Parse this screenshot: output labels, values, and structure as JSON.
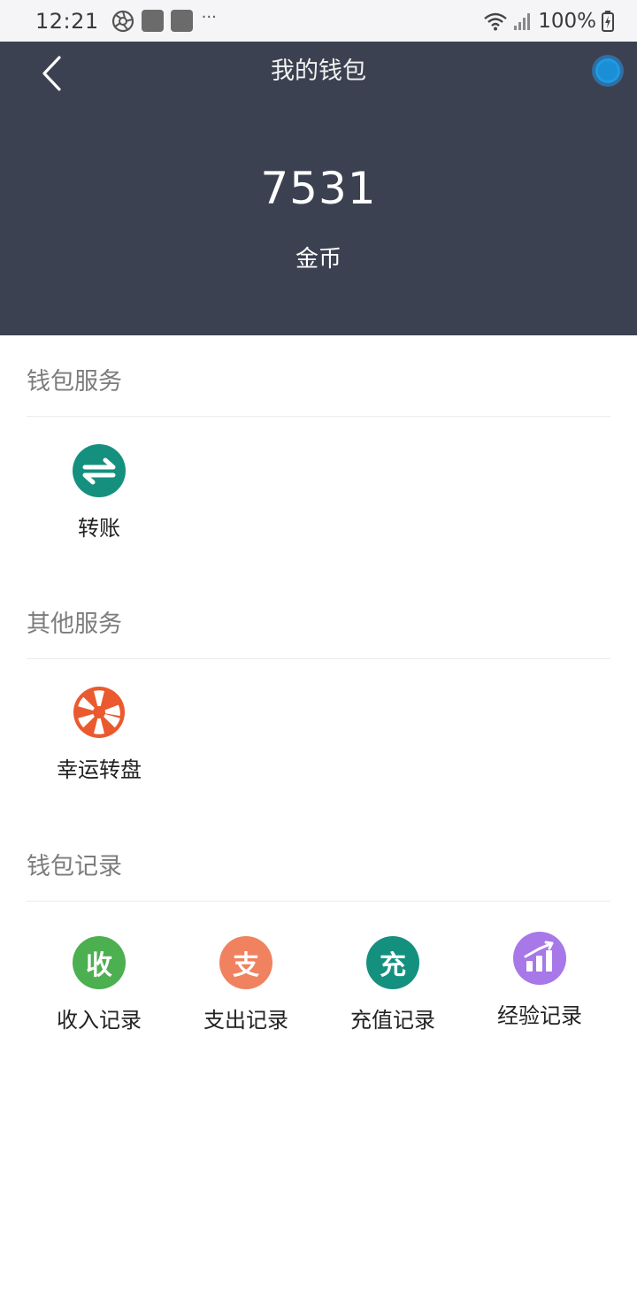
{
  "status_bar": {
    "time": "12:21",
    "dots": "···",
    "battery": "100%"
  },
  "header": {
    "title": "我的钱包",
    "balance": "7531",
    "unit": "金币"
  },
  "sections": [
    {
      "title": "钱包服务",
      "items": [
        {
          "label": "转账",
          "icon": "transfer-icon",
          "color": "#15907f"
        }
      ]
    },
    {
      "title": "其他服务",
      "items": [
        {
          "label": "幸运转盘",
          "icon": "wheel-icon",
          "color": "#ea5a2e"
        }
      ]
    },
    {
      "title": "钱包记录",
      "items": [
        {
          "label": "收入记录",
          "icon_text": "收",
          "icon": "income-icon",
          "color": "#4caf50"
        },
        {
          "label": "支出记录",
          "icon_text": "支",
          "icon": "expense-icon",
          "color": "#f08260"
        },
        {
          "label": "充值记录",
          "icon_text": "充",
          "icon": "recharge-icon",
          "color": "#14907f"
        },
        {
          "label": "经验记录",
          "icon": "chart-icon",
          "color": "#a877e8"
        }
      ]
    }
  ]
}
